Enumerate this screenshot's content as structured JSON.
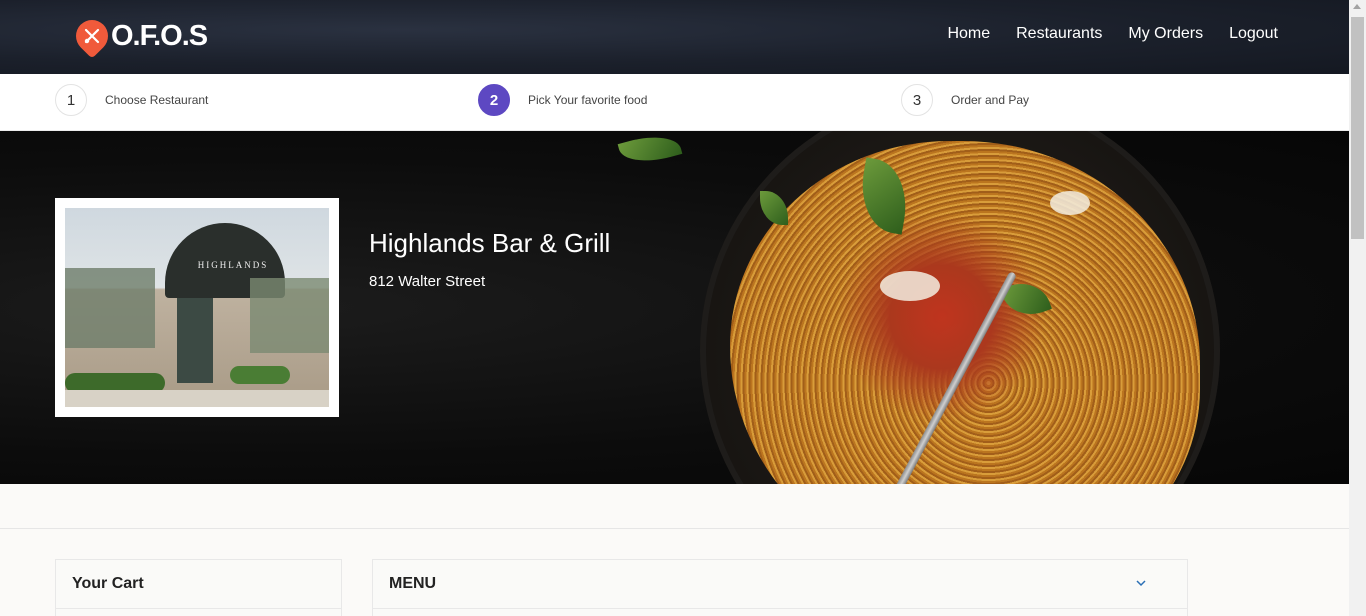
{
  "header": {
    "logo_text": "O.F.O.S",
    "nav": [
      {
        "label": "Home"
      },
      {
        "label": "Restaurants"
      },
      {
        "label": "My Orders"
      },
      {
        "label": "Logout"
      }
    ]
  },
  "steps": [
    {
      "number": "1",
      "label": "Choose Restaurant",
      "active": false
    },
    {
      "number": "2",
      "label": "Pick Your favorite food",
      "active": true
    },
    {
      "number": "3",
      "label": "Order and Pay",
      "active": false
    }
  ],
  "restaurant": {
    "name": "Highlands Bar & Grill",
    "address": "812 Walter Street",
    "photo_sign_text": "HIGHLANDS"
  },
  "cart": {
    "title": "Your Cart"
  },
  "menu": {
    "title": "MENU"
  },
  "colors": {
    "accent": "#5d48c2",
    "logo": "#f05a3b",
    "header_bg": "#1b202b"
  }
}
